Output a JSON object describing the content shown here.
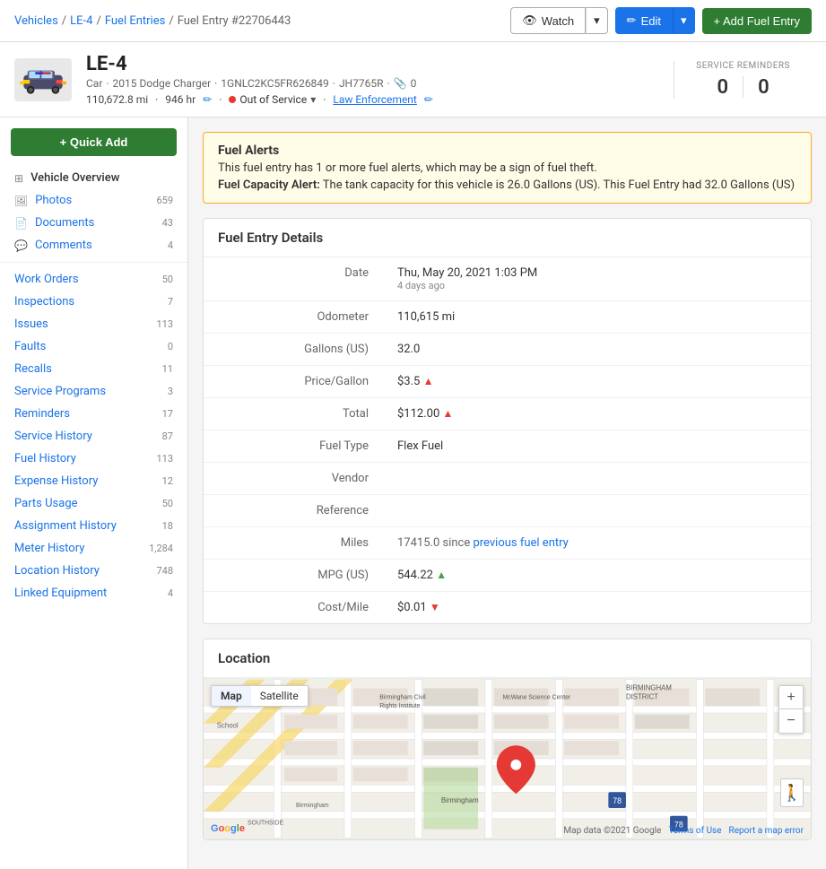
{
  "breadcrumb": {
    "vehicles": "Vehicles",
    "le4": "LE-4",
    "fuel_entries": "Fuel Entries",
    "current": "Fuel Entry #22706443"
  },
  "topbar": {
    "watch_label": "Watch",
    "edit_label": "Edit",
    "add_label": "+ Add Fuel Entry"
  },
  "vehicle": {
    "name": "LE-4",
    "type": "Car",
    "year_make_model": "2015 Dodge Charger",
    "vin": "1GNLC2KC5FR626849",
    "plate": "JH7765R",
    "attachment_count": "0",
    "odometer": "110,672.8 mi",
    "hours": "946 hr",
    "status": "Out of Service",
    "group": "Law Enforcement"
  },
  "service_reminders": {
    "label": "SERVICE REMINDERS",
    "open": "0",
    "due": "0"
  },
  "sidebar": {
    "quick_add": "+ Quick Add",
    "items": [
      {
        "label": "Vehicle Overview",
        "count": "",
        "icon": "grid"
      },
      {
        "label": "Photos",
        "count": "659",
        "icon": "photo"
      },
      {
        "label": "Documents",
        "count": "43",
        "icon": "doc"
      },
      {
        "label": "Comments",
        "count": "4",
        "icon": "comment"
      },
      {
        "label": "Work Orders",
        "count": "50",
        "icon": ""
      },
      {
        "label": "Inspections",
        "count": "7",
        "icon": ""
      },
      {
        "label": "Issues",
        "count": "113",
        "icon": ""
      },
      {
        "label": "Faults",
        "count": "0",
        "icon": ""
      },
      {
        "label": "Recalls",
        "count": "11",
        "icon": ""
      },
      {
        "label": "Service Programs",
        "count": "3",
        "icon": ""
      },
      {
        "label": "Reminders",
        "count": "17",
        "icon": ""
      },
      {
        "label": "Service History",
        "count": "87",
        "icon": ""
      },
      {
        "label": "Fuel History",
        "count": "113",
        "icon": ""
      },
      {
        "label": "Expense History",
        "count": "12",
        "icon": ""
      },
      {
        "label": "Parts Usage",
        "count": "50",
        "icon": ""
      },
      {
        "label": "Assignment History",
        "count": "18",
        "icon": ""
      },
      {
        "label": "Meter History",
        "count": "1,284",
        "icon": ""
      },
      {
        "label": "Location History",
        "count": "748",
        "icon": ""
      },
      {
        "label": "Linked Equipment",
        "count": "4",
        "icon": ""
      }
    ]
  },
  "fuel_alerts": {
    "title": "Fuel Alerts",
    "text": "This fuel entry has 1 or more fuel alerts, which may be a sign of fuel theft.",
    "capacity_label": "Fuel Capacity Alert:",
    "capacity_text": "The tank capacity for this vehicle is 26.0 Gallons (US). This Fuel Entry had 32.0 Gallons (US)"
  },
  "fuel_entry": {
    "title": "Fuel Entry Details",
    "rows": [
      {
        "label": "Date",
        "value": "Thu, May 20, 2021 1:03 PM",
        "sub": "4 days ago",
        "flag": ""
      },
      {
        "label": "Odometer",
        "value": "110,615 mi",
        "sub": "",
        "flag": ""
      },
      {
        "label": "Gallons (US)",
        "value": "32.0",
        "sub": "",
        "flag": ""
      },
      {
        "label": "Price/Gallon",
        "value": "$3.5",
        "sub": "",
        "flag": "red-up"
      },
      {
        "label": "Total",
        "value": "$112.00",
        "sub": "",
        "flag": "red-up"
      },
      {
        "label": "Fuel Type",
        "value": "Flex Fuel",
        "sub": "",
        "flag": ""
      },
      {
        "label": "Vendor",
        "value": "",
        "sub": "",
        "flag": ""
      },
      {
        "label": "Reference",
        "value": "",
        "sub": "",
        "flag": ""
      },
      {
        "label": "Miles",
        "value": "17415.0",
        "sub": "since",
        "link_text": "previous fuel entry",
        "flag": ""
      },
      {
        "label": "MPG (US)",
        "value": "544.22",
        "sub": "",
        "flag": "green-up"
      },
      {
        "label": "Cost/Mile",
        "value": "$0.01",
        "sub": "",
        "flag": "red-down"
      }
    ]
  },
  "location": {
    "title": "Location",
    "map_tab_map": "Map",
    "map_tab_satellite": "Satellite",
    "footer_data": "Map data ©2021 Google",
    "footer_terms": "Terms of Use",
    "footer_report": "Report a map error",
    "google_label": "Google"
  }
}
